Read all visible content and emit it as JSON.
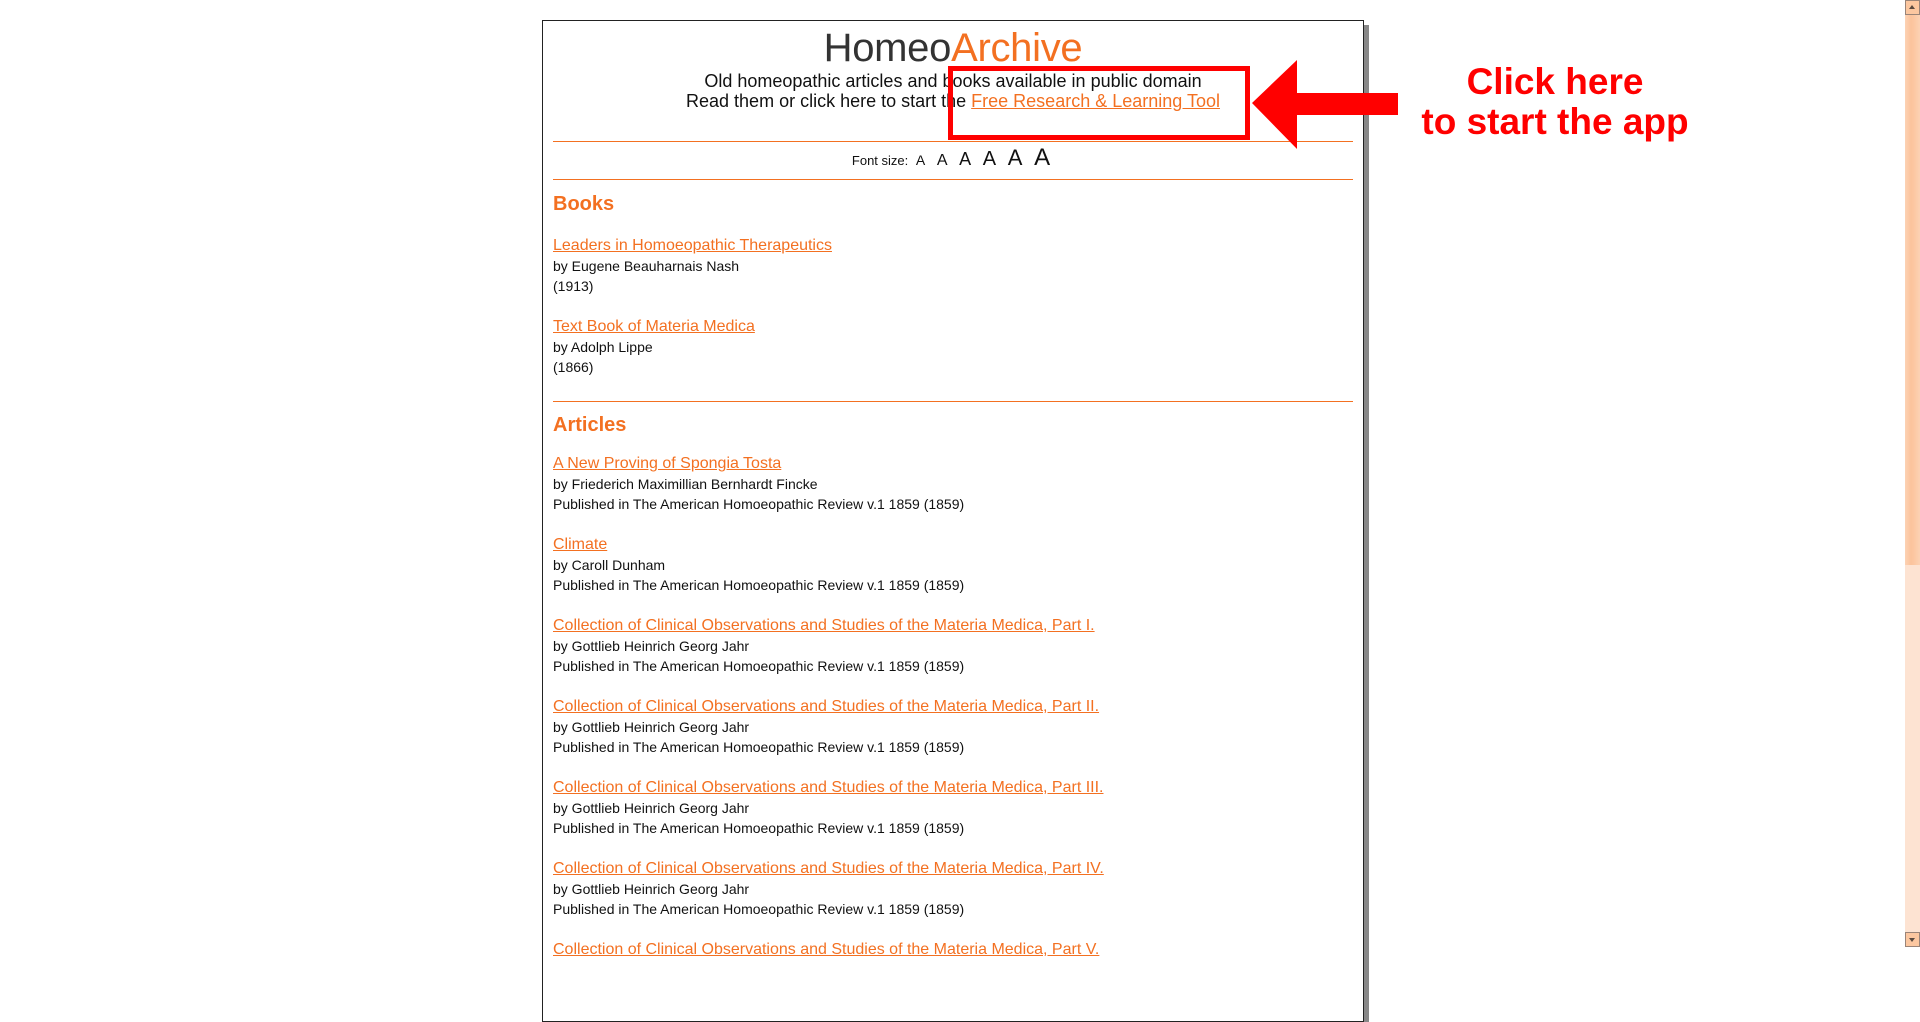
{
  "header": {
    "title_part1": "Homeo",
    "title_part2": "Archive",
    "tagline_line1": "Old homeopathic articles and books available in public domain",
    "tagline_line2_prefix": "Read them or click here to start the ",
    "app_link_label": "Free Research & Learning Tool"
  },
  "font_size": {
    "label": "Font size:",
    "options": [
      "A",
      "A",
      "A",
      "A",
      "A",
      "A"
    ]
  },
  "books": {
    "heading": "Books",
    "items": [
      {
        "title": "Leaders in Homoeopathic Therapeutics",
        "author": "by Eugene Beauharnais Nash",
        "year": "(1913)"
      },
      {
        "title": "Text Book of Materia Medica",
        "author": "by Adolph Lippe",
        "year": "(1866)"
      }
    ]
  },
  "articles": {
    "heading": "Articles",
    "items": [
      {
        "title": "A New Proving of Spongia Tosta",
        "author": "by Friederich Maximillian Bernhardt Fincke",
        "published": "Published in The American Homoeopathic Review v.1 1859 (1859)"
      },
      {
        "title": "Climate",
        "author": "by Caroll Dunham",
        "published": "Published in The American Homoeopathic Review v.1 1859 (1859)"
      },
      {
        "title": "Collection of Clinical Observations and Studies of the Materia Medica, Part I.",
        "author": "by Gottlieb Heinrich Georg Jahr",
        "published": "Published in The American Homoeopathic Review v.1 1859 (1859)"
      },
      {
        "title": "Collection of Clinical Observations and Studies of the Materia Medica, Part II.",
        "author": "by Gottlieb Heinrich Georg Jahr",
        "published": "Published in The American Homoeopathic Review v.1 1859 (1859)"
      },
      {
        "title": "Collection of Clinical Observations and Studies of the Materia Medica, Part III.",
        "author": "by Gottlieb Heinrich Georg Jahr",
        "published": "Published in The American Homoeopathic Review v.1 1859 (1859)"
      },
      {
        "title": "Collection of Clinical Observations and Studies of the Materia Medica, Part IV.",
        "author": "by Gottlieb Heinrich Georg Jahr",
        "published": "Published in The American Homoeopathic Review v.1 1859 (1859)"
      },
      {
        "title": "Collection of Clinical Observations and Studies of the Materia Medica, Part V.",
        "author": "",
        "published": ""
      }
    ]
  },
  "annotation": {
    "callout_line1": "Click here",
    "callout_line2": "to start the app",
    "color": "#ff0000"
  },
  "colors": {
    "accent": "#f37021",
    "text": "#111111",
    "title_dark": "#333333"
  },
  "scrollbar": {
    "thumb_position_fraction": 0.0,
    "visible_fraction": 0.6
  }
}
